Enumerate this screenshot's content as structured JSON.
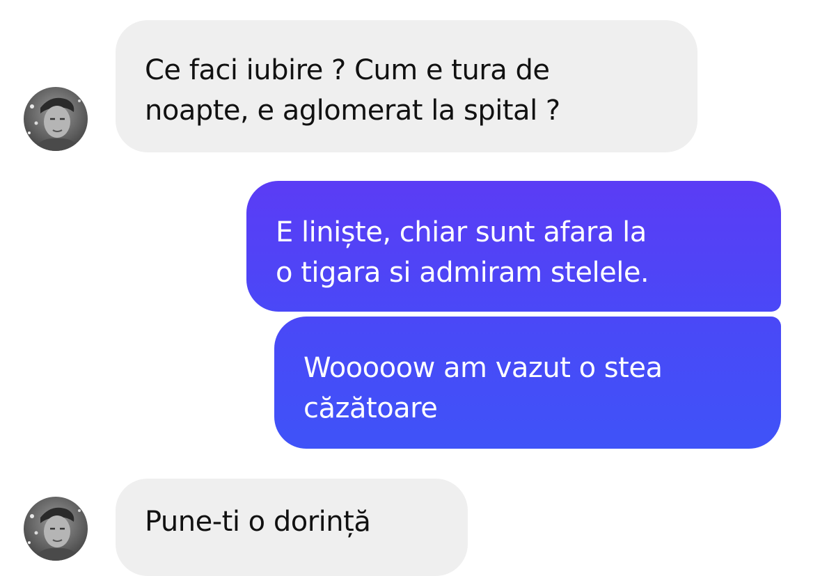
{
  "colors": {
    "incoming_bubble": "#efefef",
    "outgoing_gradient_top": "#5b3cf5",
    "outgoing_gradient_bottom": "#3f53f8",
    "incoming_text": "#111111",
    "outgoing_text": "#ffffff"
  },
  "messages": [
    {
      "direction": "incoming",
      "text": "Ce faci iubire ? Cum e tura de\nnoapte, e aglomerat la spital ?",
      "avatar": "contact-avatar"
    },
    {
      "direction": "outgoing",
      "text": "E liniște, chiar sunt afara la\no tigara si admiram stelele."
    },
    {
      "direction": "outgoing",
      "text": "Wooooow am vazut o stea\ncăzătoare"
    },
    {
      "direction": "incoming",
      "text": "Pune-ti o dorință",
      "avatar": "contact-avatar"
    }
  ]
}
